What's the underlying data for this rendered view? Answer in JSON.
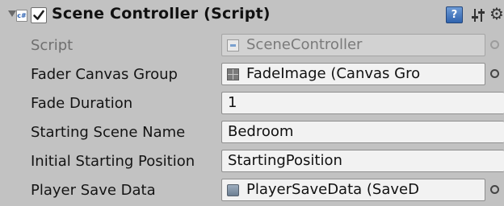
{
  "component": {
    "title": "Scene Controller (Script)",
    "enabled": true,
    "script_icon_text": "c#",
    "help_icon_text": "?",
    "icons": {
      "foldout": "foldout-expanded-icon",
      "script": "csharp-script-icon",
      "help": "help-icon",
      "preset": "preset-sliders-icon",
      "settings": "gear-icon"
    }
  },
  "fields": [
    {
      "label": "Script",
      "value": "SceneController",
      "kind": "object",
      "icon": "script-asset-icon",
      "disabled": true
    },
    {
      "label": "Fader Canvas Group",
      "value": "FadeImage (Canvas Gro",
      "kind": "object",
      "icon": "canvas-group-icon",
      "disabled": false
    },
    {
      "label": "Fade Duration",
      "value": "1",
      "kind": "number",
      "disabled": false
    },
    {
      "label": "Starting Scene Name",
      "value": "Bedroom",
      "kind": "text",
      "disabled": false
    },
    {
      "label": "Initial Starting Position",
      "value": "StartingPosition",
      "kind": "enum",
      "disabled": false
    },
    {
      "label": "Player Save Data",
      "value": "PlayerSaveData (SaveD",
      "kind": "object",
      "icon": "scriptable-object-icon",
      "disabled": false
    }
  ],
  "colors": {
    "background": "#c2c2c2",
    "field_background": "#f2f2f2",
    "help_icon": "#2f63ae"
  }
}
